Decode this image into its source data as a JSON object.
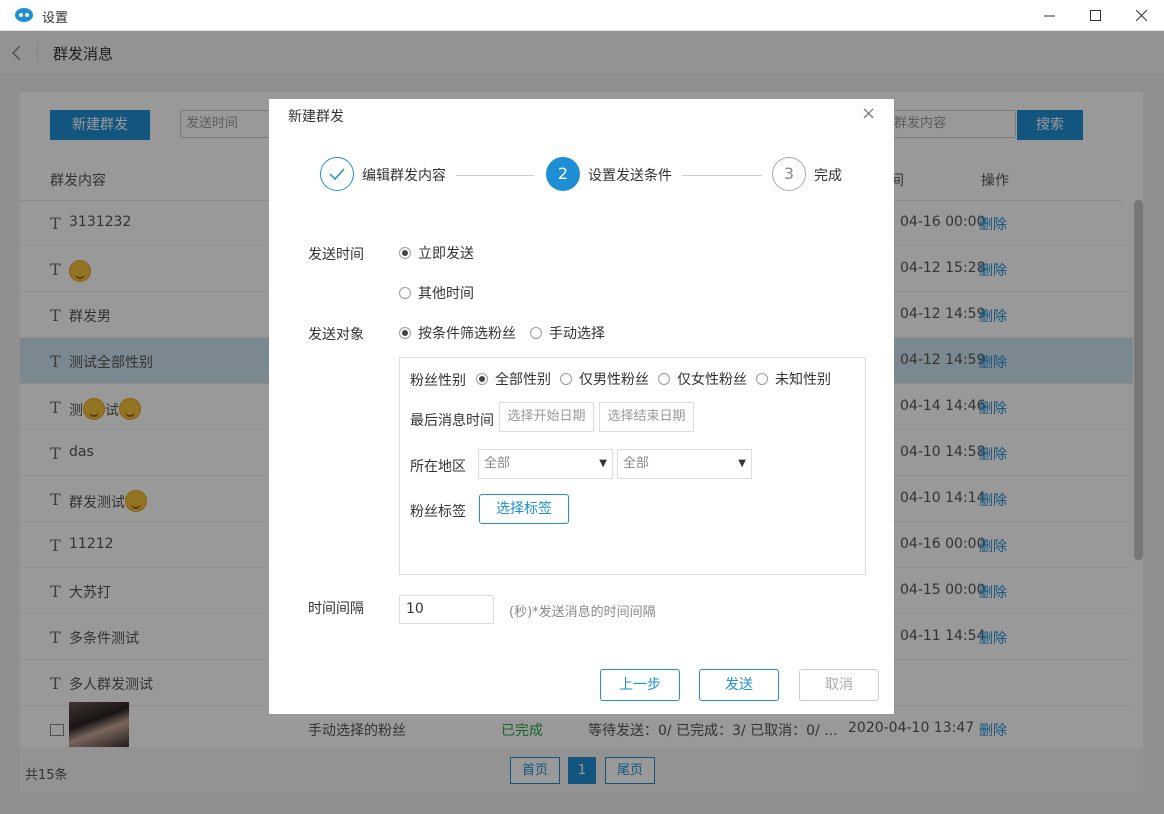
{
  "window": {
    "title": "设置"
  },
  "header": {
    "title": "群发消息"
  },
  "toolbar": {
    "new_button": "新建群发",
    "time_placeholder": "发送时间",
    "search_placeholder": "群发内容",
    "search_button": "搜索"
  },
  "table": {
    "col_content": "群发内容",
    "col_time": "间",
    "col_op": "操作",
    "delete_label": "删除",
    "rows": [
      {
        "text": "3131232",
        "time": "04-16 00:00"
      },
      {
        "text": "",
        "time": "04-12 15:28"
      },
      {
        "text": "群发男",
        "time": "04-12 14:59"
      },
      {
        "text": "测试全部性别",
        "time": "04-12 14:59"
      },
      {
        "text_a": "测",
        "text_b": "试",
        "time": "04-14 14:46"
      },
      {
        "text": "das",
        "time": "04-10 14:58"
      },
      {
        "text": "群发测试",
        "time": "04-10 14:14"
      },
      {
        "text": "11212",
        "time": "04-16 00:00"
      },
      {
        "text": "大苏打",
        "time": "04-15 00:00"
      },
      {
        "text": "多条件测试",
        "time": "04-11 14:54"
      },
      {
        "text": "多人群发测试",
        "time": ""
      }
    ],
    "last_row": {
      "target": "手动选择的粉丝",
      "status": "已完成",
      "stats": "等待发送：0/ 已完成：3/ 已取消：0/ ...",
      "time": "2020-04-10 13:47"
    }
  },
  "footer": {
    "total": "共15条",
    "first": "首页",
    "page": "1",
    "last": "尾页"
  },
  "modal": {
    "title": "新建群发",
    "steps": [
      {
        "num": "",
        "label": "编辑群发内容"
      },
      {
        "num": "2",
        "label": "设置发送条件"
      },
      {
        "num": "3",
        "label": "完成"
      }
    ],
    "send_time_label": "发送时间",
    "send_now": "立即发送",
    "send_other": "其他时间",
    "target_label": "发送对象",
    "target_filter": "按条件筛选粉丝",
    "target_manual": "手动选择",
    "gender_label": "粉丝性别",
    "gender_all": "全部性别",
    "gender_male": "仅男性粉丝",
    "gender_female": "仅女性粉丝",
    "gender_unknown": "未知性别",
    "last_msg_label": "最后消息时间",
    "start_date_placeholder": "选择开始日期",
    "end_date_placeholder": "选择结束日期",
    "region_label": "所在地区",
    "region1": "全部",
    "region2": "全部",
    "tag_label": "粉丝标签",
    "tag_button": "选择标签",
    "interval_label": "时间间隔",
    "interval_value": "10",
    "interval_hint": "(秒)*发送消息的时间间隔",
    "prev_button": "上一步",
    "send_button": "发送",
    "cancel_button": "取消"
  },
  "colors": {
    "accent": "#1e8fd5",
    "success": "#2aa744",
    "selected_row": "#cfe3ef"
  }
}
